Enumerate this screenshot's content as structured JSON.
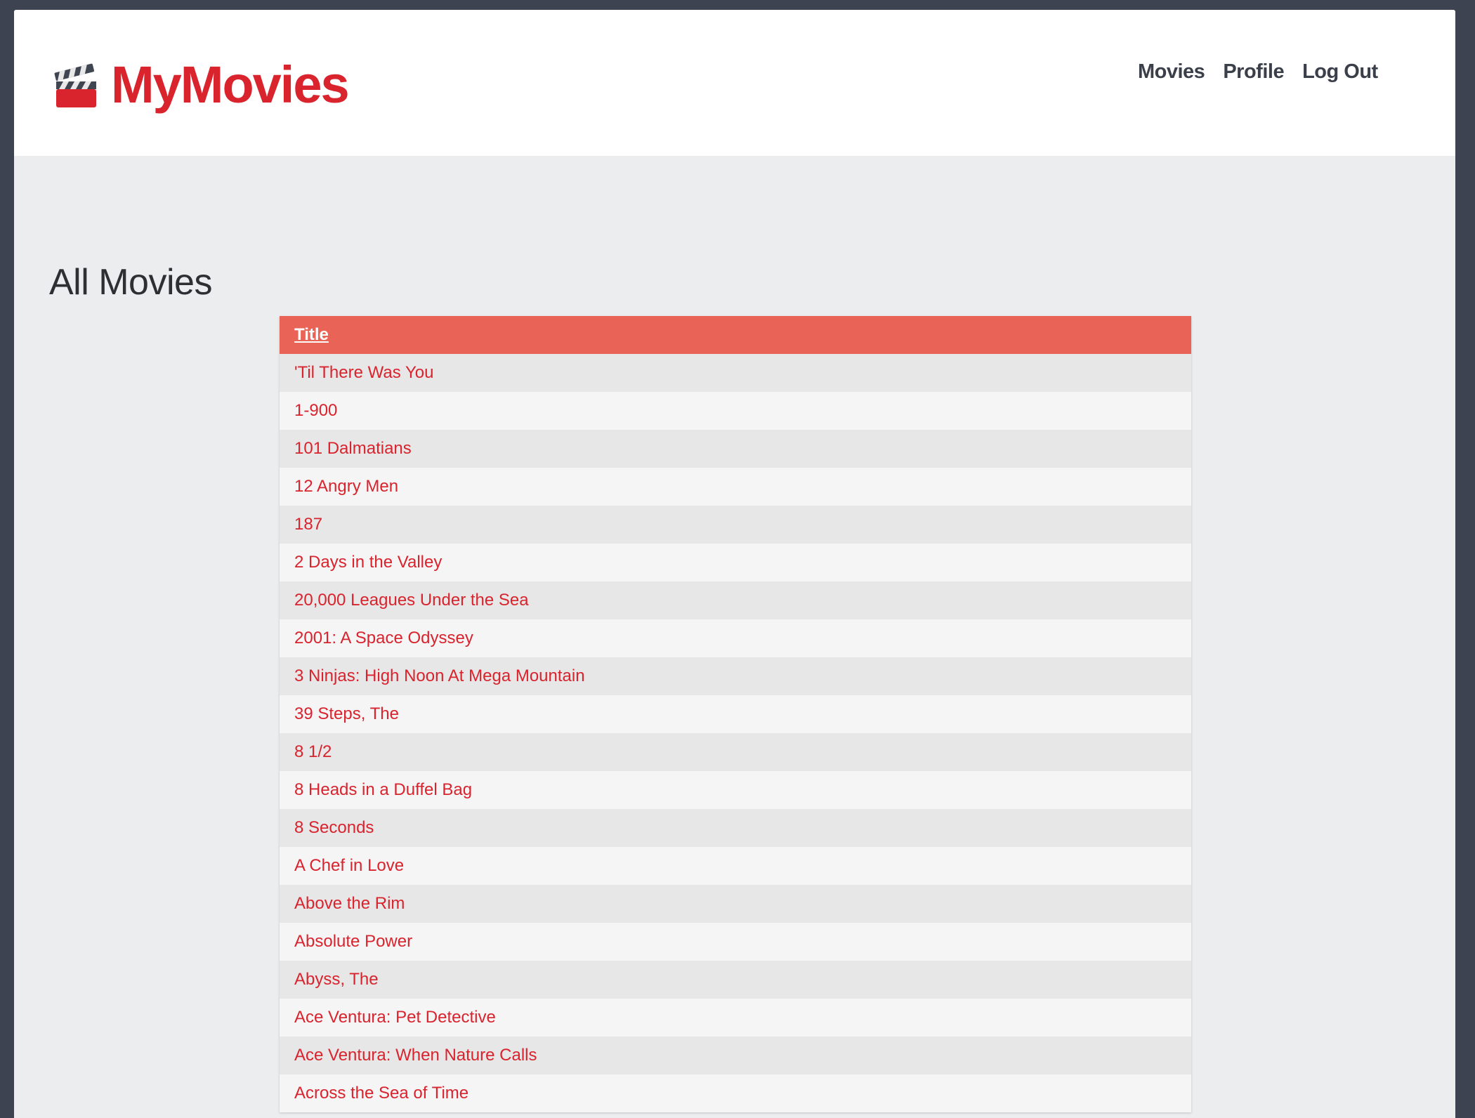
{
  "brand": {
    "name": "MyMovies",
    "icon": "clapperboard-icon",
    "color": "#d9232d"
  },
  "nav": {
    "movies": "Movies",
    "profile": "Profile",
    "logout": "Log Out"
  },
  "page": {
    "title": "All Movies"
  },
  "table": {
    "header": {
      "title": "Title",
      "color": "#e96457"
    },
    "rows": [
      "'Til There Was You",
      "1-900",
      "101 Dalmatians",
      "12 Angry Men",
      "187",
      "2 Days in the Valley",
      "20,000 Leagues Under the Sea",
      "2001: A Space Odyssey",
      "3 Ninjas: High Noon At Mega Mountain",
      "39 Steps, The",
      "8 1/2",
      "8 Heads in a Duffel Bag",
      "8 Seconds",
      "A Chef in Love",
      "Above the Rim",
      "Absolute Power",
      "Abyss, The",
      "Ace Ventura: Pet Detective",
      "Ace Ventura: When Nature Calls",
      "Across the Sea of Time"
    ]
  }
}
